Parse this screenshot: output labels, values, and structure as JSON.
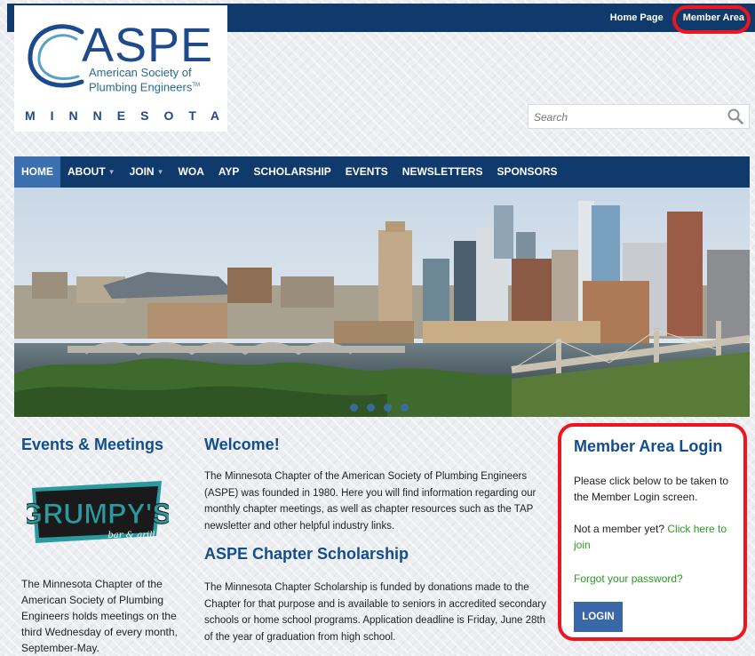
{
  "topbar": {
    "home_label": "Home Page",
    "member_label": "Member Area"
  },
  "logo": {
    "title": "ASPE",
    "subtitle_line1": "American Society of",
    "subtitle_line2": "Plumbing Engineers",
    "tm": "TM",
    "state": "MINNESOTA"
  },
  "search": {
    "placeholder": "Search"
  },
  "nav": {
    "items": [
      {
        "label": "HOME",
        "dropdown": false,
        "active": true
      },
      {
        "label": "ABOUT",
        "dropdown": true
      },
      {
        "label": "JOIN",
        "dropdown": true
      },
      {
        "label": "WOA",
        "dropdown": false
      },
      {
        "label": "AYP",
        "dropdown": false
      },
      {
        "label": "SCHOLARSHIP",
        "dropdown": false
      },
      {
        "label": "EVENTS",
        "dropdown": false
      },
      {
        "label": "NEWSLETTERS",
        "dropdown": false
      },
      {
        "label": "SPONSORS",
        "dropdown": false
      }
    ]
  },
  "left": {
    "heading": "Events & Meetings",
    "sponsor_name": "GRUMPY'S",
    "sponsor_tag": "bar & grill",
    "text": "The Minnesota Chapter of the American Society of Plumbing Engineers holds meetings on the third Wednesday of every month, September-May."
  },
  "main": {
    "welcome_title": "Welcome!",
    "welcome_text": "The Minnesota Chapter of the American Society of Plumbing Engineers (ASPE) was founded in 1980. Here you will find information regarding our monthly chapter meetings, as well as chapter resources such as the TAP newsletter and other helpful industry links.",
    "scholarship_title": "ASPE Chapter Scholarship",
    "scholarship_text": "The Minnesota Chapter Scholarship is funded by donations made to the Chapter for that purpose and is available to seniors in accredited secondary schools or home school programs. Application deadline is Friday, June 28th of the year of graduation from high school."
  },
  "login_card": {
    "title": "Member Area Login",
    "text": "Please click below to be taken to the Member Login screen.",
    "not_member": "Not a member yet? ",
    "join_link": "Click here to join",
    "forgot_link": "Forgot your password?",
    "login_button": "LOGIN"
  },
  "colors": {
    "navy": "#0f3a6b",
    "accent_blue": "#3a6fb0",
    "heading_blue": "#124e8c",
    "link_green": "#2b9a22",
    "highlight_red": "#f0141e"
  },
  "icons": {
    "search": "search-icon"
  }
}
